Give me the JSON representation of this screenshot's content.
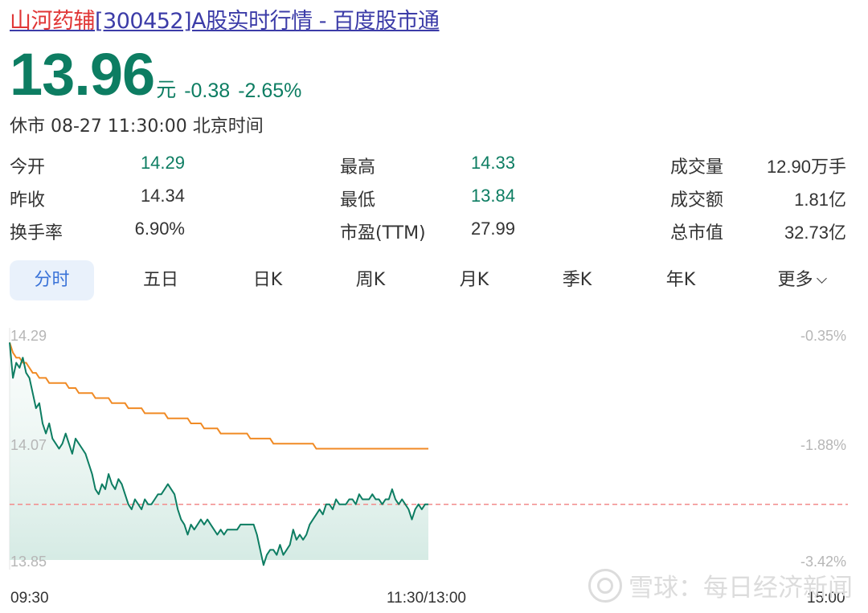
{
  "title": {
    "name": "山河药辅",
    "rest": "[300452]A股实时行情 - 百度股市通"
  },
  "quote": {
    "price": "13.96",
    "unit": "元",
    "change": "-0.38",
    "change_pct": "-2.65%",
    "status": "休市 08-27 11:30:00 北京时间"
  },
  "stats": [
    {
      "label": "今开",
      "value": "14.29"
    },
    {
      "label": "最高",
      "value": "14.33"
    },
    {
      "label": "成交量",
      "value": "12.90万手"
    },
    {
      "label": "昨收",
      "value": "14.34"
    },
    {
      "label": "最低",
      "value": "13.84"
    },
    {
      "label": "成交额",
      "value": "1.81亿"
    },
    {
      "label": "换手率",
      "value": "6.90%"
    },
    {
      "label": "市盈(TTM)",
      "value": "27.99"
    },
    {
      "label": "总市值",
      "value": "32.73亿"
    }
  ],
  "tabs": [
    "分时",
    "五日",
    "日K",
    "周K",
    "月K",
    "季K",
    "年K",
    "更多"
  ],
  "active_tab": "分时",
  "chart_data": {
    "type": "line",
    "y_axis_left": [
      "14.29",
      "14.07",
      "13.85"
    ],
    "y_axis_right": [
      "-0.35%",
      "-1.88%",
      "-3.42%"
    ],
    "x_axis": [
      "09:30",
      "11:30/13:00",
      "15:00"
    ],
    "ylim": [
      13.85,
      14.29
    ],
    "prev_close": 13.96,
    "series": [
      {
        "color": "#0d7d62",
        "values": [
          14.28,
          14.21,
          14.24,
          14.23,
          14.25,
          14.22,
          14.21,
          14.18,
          14.15,
          14.16,
          14.12,
          14.1,
          14.12,
          14.09,
          14.08,
          14.07,
          14.08,
          14.1,
          14.08,
          14.06,
          14.09,
          14.08,
          14.07,
          14.06,
          14.04,
          14.02,
          13.99,
          13.98,
          14.0,
          13.99,
          14.02,
          14.0,
          13.99,
          14.01,
          14.0,
          13.98,
          13.96,
          13.95,
          13.97,
          13.96,
          13.95,
          13.97,
          13.96,
          13.96,
          13.97,
          13.98,
          13.98,
          13.99,
          14.0,
          13.99,
          13.98,
          13.95,
          13.93,
          13.92,
          13.9,
          13.92,
          13.91,
          13.92,
          13.93,
          13.92,
          13.93,
          13.92,
          13.91,
          13.9,
          13.91,
          13.9,
          13.91,
          13.91,
          13.91,
          13.91,
          13.92,
          13.92,
          13.92,
          13.92,
          13.92,
          13.9,
          13.87,
          13.84,
          13.86,
          13.87,
          13.87,
          13.86,
          13.88,
          13.86,
          13.87,
          13.88,
          13.91,
          13.89,
          13.9,
          13.89,
          13.9,
          13.92,
          13.93,
          13.94,
          13.95,
          13.94,
          13.96,
          13.96,
          13.95,
          13.97,
          13.96,
          13.96,
          13.96,
          13.97,
          13.97,
          13.96,
          13.98,
          13.97,
          13.97,
          13.97,
          13.98,
          13.97,
          13.97,
          13.96,
          13.97,
          13.97,
          13.99,
          13.97,
          13.96,
          13.97,
          13.96,
          13.95,
          13.93,
          13.95,
          13.96,
          13.95,
          13.96,
          13.96
        ]
      },
      {
        "color": "#f08a24",
        "values": [
          14.28,
          14.26,
          14.25,
          14.25,
          14.24,
          14.24,
          14.23,
          14.22,
          14.22,
          14.21,
          14.21,
          14.21,
          14.2,
          14.2,
          14.2,
          14.2,
          14.2,
          14.2,
          14.19,
          14.19,
          14.19,
          14.18,
          14.18,
          14.18,
          14.18,
          14.18,
          14.17,
          14.17,
          14.17,
          14.17,
          14.17,
          14.16,
          14.16,
          14.16,
          14.16,
          14.16,
          14.15,
          14.15,
          14.15,
          14.15,
          14.15,
          14.14,
          14.14,
          14.14,
          14.14,
          14.14,
          14.14,
          14.14,
          14.13,
          14.13,
          14.13,
          14.13,
          14.13,
          14.13,
          14.13,
          14.12,
          14.12,
          14.12,
          14.12,
          14.11,
          14.11,
          14.11,
          14.11,
          14.11,
          14.1,
          14.1,
          14.1,
          14.1,
          14.1,
          14.1,
          14.1,
          14.1,
          14.1,
          14.09,
          14.09,
          14.09,
          14.09,
          14.09,
          14.09,
          14.09,
          14.08,
          14.08,
          14.08,
          14.08,
          14.08,
          14.08,
          14.08,
          14.08,
          14.08,
          14.08,
          14.08,
          14.08,
          14.08,
          14.07,
          14.07,
          14.07,
          14.07,
          14.07,
          14.07,
          14.07,
          14.07,
          14.07,
          14.07,
          14.07,
          14.07,
          14.07,
          14.07,
          14.07,
          14.07,
          14.07,
          14.07,
          14.07,
          14.07,
          14.07,
          14.07,
          14.07,
          14.07,
          14.07,
          14.07,
          14.07,
          14.07,
          14.07,
          14.07,
          14.07,
          14.07,
          14.07,
          14.07,
          14.07
        ]
      }
    ]
  },
  "watermark": "雪球：每日经济新闻",
  "colors": {
    "down": "#0d7d62",
    "avg": "#f08a24",
    "ref_line": "#f28b8b",
    "tab_active": "#3a73d8"
  }
}
